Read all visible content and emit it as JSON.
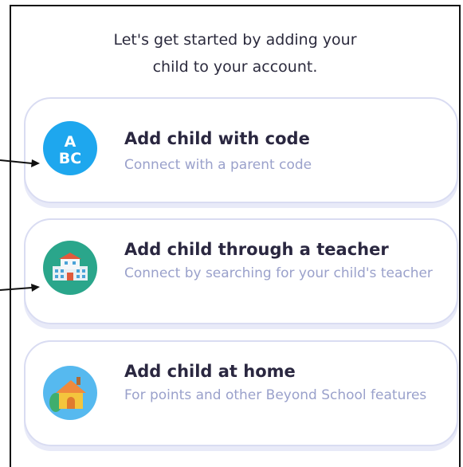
{
  "intro": {
    "line1": "Let's get started by adding your",
    "line2": "child to your account."
  },
  "options": [
    {
      "title": "Add child with code",
      "subtitle": "Connect with a parent code",
      "icon": "abc-code-icon",
      "icon_text": [
        "A",
        "BC"
      ],
      "color": "#1ea7ee"
    },
    {
      "title": "Add child through a teacher",
      "subtitle": "Connect by searching for your child's teacher",
      "icon": "school-building-icon",
      "color": "#2aa68b"
    },
    {
      "title": "Add child at home",
      "subtitle": "For points and other Beyond School features",
      "icon": "house-icon",
      "color": "#56b9ef"
    }
  ],
  "colors": {
    "title": "#2a2740",
    "subtitle": "#9aa1cb",
    "card_border": "#d9dcf2"
  }
}
